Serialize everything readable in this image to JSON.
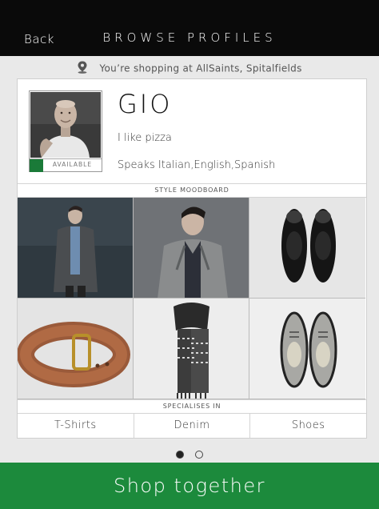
{
  "header": {
    "back_label": "Back",
    "title": "BROWSE PROFILES"
  },
  "location": {
    "icon": "map-pin-icon",
    "text": "You’re shopping at AllSaints, Spitalfields"
  },
  "profile": {
    "name": "GIO",
    "tagline": "I like pizza",
    "languages": "Speaks Italian,English,Spanish",
    "availability": "AVAILABLE",
    "availability_color": "#1a7a38"
  },
  "moodboard": {
    "label": "STYLE MOODBOARD",
    "items": [
      {
        "name": "moodboard-grey-coat-outfit"
      },
      {
        "name": "moodboard-leather-jacket-outfit"
      },
      {
        "name": "moodboard-black-brogues"
      },
      {
        "name": "moodboard-brown-belt"
      },
      {
        "name": "moodboard-knit-scarf"
      },
      {
        "name": "moodboard-grey-brogues"
      }
    ]
  },
  "specialises": {
    "label": "SPECIALISES IN",
    "items": [
      "T-Shirts",
      "Denim",
      "Shoes"
    ]
  },
  "pager": {
    "pages": 2,
    "current": 1
  },
  "cta": {
    "label": "Shop together",
    "color": "#1c8a3c"
  }
}
